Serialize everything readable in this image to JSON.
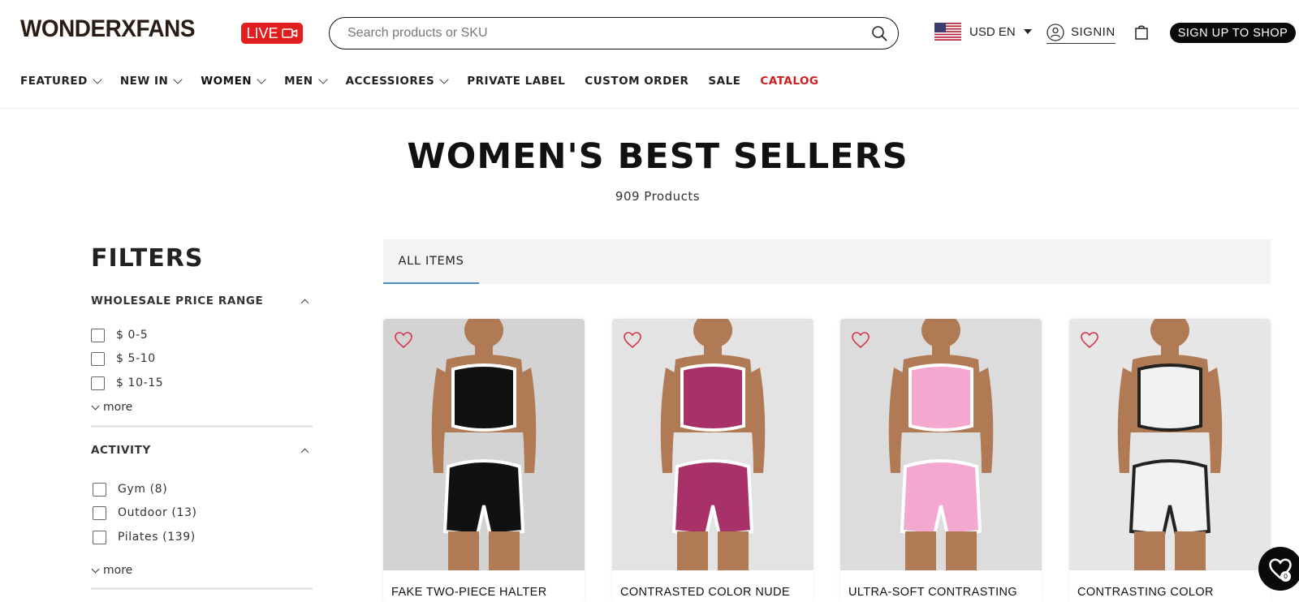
{
  "header": {
    "logo": "WONDERXFANS",
    "live_label": "LIVE",
    "search_placeholder": "Search products or SKU",
    "currency_label": "USD EN",
    "signin_label": "SIGNIN",
    "signup_label": "SIGN UP TO SHOP",
    "icons": [
      "video-camera-icon",
      "search-icon",
      "us-flag-icon",
      "caret-down-icon",
      "user-icon",
      "shopping-bag-icon"
    ]
  },
  "nav": {
    "items": [
      {
        "label": "FEATURED",
        "has_dropdown": true
      },
      {
        "label": "NEW IN",
        "has_dropdown": true
      },
      {
        "label": "WOMEN",
        "has_dropdown": true
      },
      {
        "label": "MEN",
        "has_dropdown": true
      },
      {
        "label": "ACCESSIORES",
        "has_dropdown": true
      },
      {
        "label": "PRIVATE LABEL",
        "has_dropdown": false
      },
      {
        "label": "CUSTOM ORDER",
        "has_dropdown": false
      },
      {
        "label": "SALE",
        "has_dropdown": false
      },
      {
        "label": "CATALOG",
        "has_dropdown": false,
        "color": "#d01e1e"
      }
    ]
  },
  "page": {
    "title": "WOMEN'S BEST SELLERS",
    "product_count": "909 Products"
  },
  "filters": {
    "title": "FILTERS",
    "groups": [
      {
        "title": "WHOLESALE PRICE RANGE",
        "options": [
          "$ 0-5",
          "$ 5-10",
          "$ 10-15"
        ],
        "more_label": "more"
      },
      {
        "title": "ACTIVITY",
        "options": [
          "Gym (8)",
          "Outdoor (13)",
          "Pilates (139)"
        ],
        "more_label": "more"
      }
    ]
  },
  "tabs": {
    "items": [
      {
        "label": "ALL ITEMS",
        "active": true
      }
    ],
    "active_color": "#4a90c2"
  },
  "products": [
    {
      "name": "FAKE TWO-PIECE HALTER",
      "colors": {
        "top": "#111111",
        "bottom": "#111111",
        "trim": "#ffffff",
        "bg": "#d3d3d3"
      }
    },
    {
      "name": "CONTRASTED COLOR NUDE",
      "colors": {
        "top": "#a8316a",
        "bottom": "#a8316a",
        "trim": "#ffffff",
        "bg": "#e3e3e3"
      }
    },
    {
      "name": "ULTRA-SOFT CONTRASTING",
      "colors": {
        "top": "#f5a8cf",
        "bottom": "#f5a8cf",
        "trim": "#ffffff",
        "bg": "#dcdcdc"
      }
    },
    {
      "name": "CONTRASTING COLOR",
      "colors": {
        "top": "#f2f2f2",
        "bottom": "#f2f2f2",
        "trim": "#222222",
        "bg": "#e6e6e6"
      }
    }
  ],
  "wishlist": {
    "count": "0"
  },
  "colors": {
    "accent_red": "#e11d1d",
    "brand_dark": "#0a0a0a"
  }
}
